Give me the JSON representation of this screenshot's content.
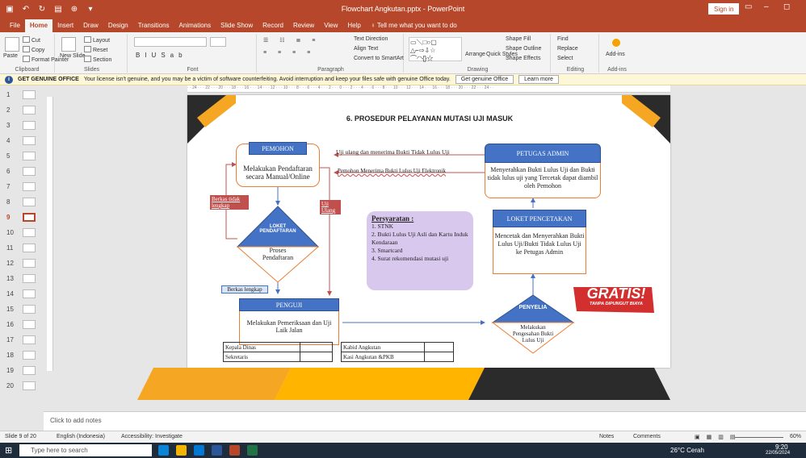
{
  "app": {
    "title": "Flowchart Angkutan.pptx - PowerPoint",
    "sign_in": "Sign in"
  },
  "tabs": [
    "File",
    "Home",
    "Insert",
    "Draw",
    "Design",
    "Transitions",
    "Animations",
    "Slide Show",
    "Record",
    "Review",
    "View",
    "Help",
    "Tell me what you want to do"
  ],
  "ribbon": {
    "clipboard": {
      "label": "Clipboard",
      "paste": "Paste",
      "cut": "Cut",
      "copy": "Copy",
      "format_painter": "Format Painter"
    },
    "slides": {
      "label": "Slides",
      "new_slide": "New Slide",
      "layout": "Layout",
      "reset": "Reset",
      "section": "Section"
    },
    "font": {
      "label": "Font"
    },
    "paragraph": {
      "label": "Paragraph",
      "text_direction": "Text Direction",
      "align_text": "Align Text",
      "convert": "Convert to SmartArt"
    },
    "drawing": {
      "label": "Drawing",
      "arrange": "Arrange",
      "quick_styles": "Quick Styles",
      "shape_fill": "Shape Fill",
      "shape_outline": "Shape Outline",
      "shape_effects": "Shape Effects"
    },
    "editing": {
      "label": "Editing",
      "find": "Find",
      "replace": "Replace",
      "select": "Select"
    },
    "addins": {
      "label": "Add-ins",
      "addins": "Add-ins"
    }
  },
  "infobar": {
    "title": "GET GENUINE OFFICE",
    "message": "Your license isn't genuine, and you may be a victim of software counterfeiting. Avoid interruption and keep your files safe with genuine Office today.",
    "btn1": "Get genuine Office",
    "btn2": "Learn more"
  },
  "thumbnails": [
    "1",
    "2",
    "3",
    "4",
    "5",
    "6",
    "7",
    "8",
    "9",
    "10",
    "11",
    "12",
    "13",
    "14",
    "15",
    "16",
    "17",
    "18",
    "19",
    "20"
  ],
  "selected_slide": 9,
  "slide": {
    "title": "6. PROSEDUR PELAYANAN MUTASI UJI MASUK",
    "pemohon": {
      "header": "PEMOHON",
      "body": "Melakukan Pendaftaran secara Manual/Online"
    },
    "loket": {
      "header": "LOKET PENDAFTARAN",
      "body": "Proses Pendaftaran"
    },
    "penguji": {
      "header": "PENGUJI",
      "body": "Melakukan Pemeriksaan dan Uji Laik Jalan"
    },
    "petugas": {
      "header": "PETUGAS ADMIN",
      "body": "Menyerahkan Bukti Lulus Uji dan Bukti tidak lulus uji yang Tercetak dapat diambil oleh Pemohon"
    },
    "cetak": {
      "header": "LOKET PENCETAKAN",
      "body": "Mencetak dan Menyerahkan Bukti Lulus Uji/Bukti Tidak Lulus Uji ke Petugas Admin"
    },
    "penyelia": {
      "header": "PENYELIA",
      "body": "Melakukan Pengesahan Bukti Lulus Uji"
    },
    "arrow_top": "Uji ulang dan menerima Bukti Tidak Lulus Uji",
    "arrow_mid": "Pemohon Menerima Bukti Lulus Uji Elektronik",
    "berkas_tidak": "Berkas tidak lengkap",
    "uji_ulang": "Uji Ulang",
    "berkas_lengkap": "Berkas lengkap",
    "syarat_title": "Persyaratan :",
    "syarat": [
      "1. STNK",
      "2. Bukti Lulus Uji Asli dan Kartu Induk Kendaraan",
      "3. Smartcard",
      "4. Surat rekomendasi mutasi uji"
    ],
    "gratis": "GRATIS!",
    "gratis_sub": "TANPA DIPUNGUT BIAYA",
    "sign_left": [
      "Kepala Dinas",
      "Sekretaris"
    ],
    "sign_right": [
      "Kabid Angkutan",
      "Kasi Angkutan &PKB"
    ]
  },
  "notes_placeholder": "Click to add notes",
  "status": {
    "slide": "Slide 9 of 20",
    "lang": "English (Indonesia)",
    "access": "Accessibility: Investigate",
    "notes": "Notes",
    "comments": "Comments",
    "zoom": "60%"
  },
  "taskbar": {
    "search": "Type here to search",
    "weather": "26°C Cerah",
    "time": "9:20",
    "date": "22/05/2024"
  }
}
